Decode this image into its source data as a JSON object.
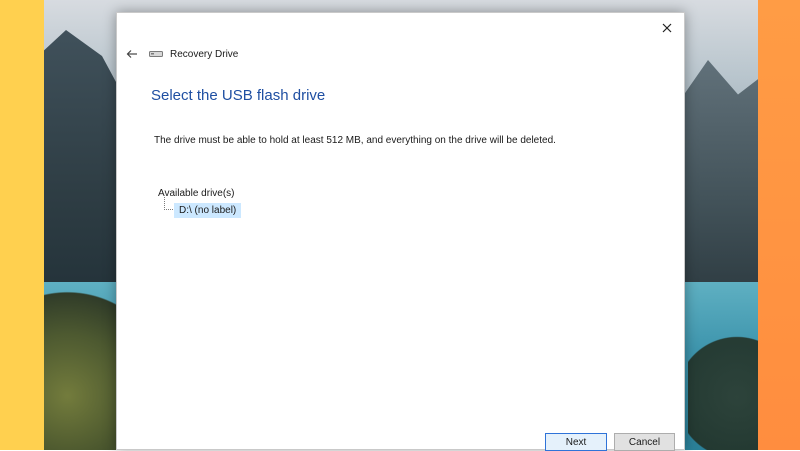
{
  "window": {
    "title": "Recovery Drive"
  },
  "page": {
    "heading": "Select the USB flash drive",
    "description": "The drive must be able to hold at least 512 MB, and everything on the drive will be deleted."
  },
  "drives": {
    "root_label": "Available drive(s)",
    "items": [
      {
        "label": "D:\\ (no label)",
        "selected": true
      }
    ]
  },
  "buttons": {
    "next_label": "Next",
    "cancel_label": "Cancel"
  },
  "icons": {
    "back": "back-arrow-icon",
    "close": "close-icon",
    "drive": "drive-icon"
  },
  "colors": {
    "heading": "#1f4fa2",
    "selection": "#cce8ff",
    "primary_border": "#2f73d8",
    "frame_left": "#ffd04f",
    "frame_right": "#ff9c45"
  }
}
